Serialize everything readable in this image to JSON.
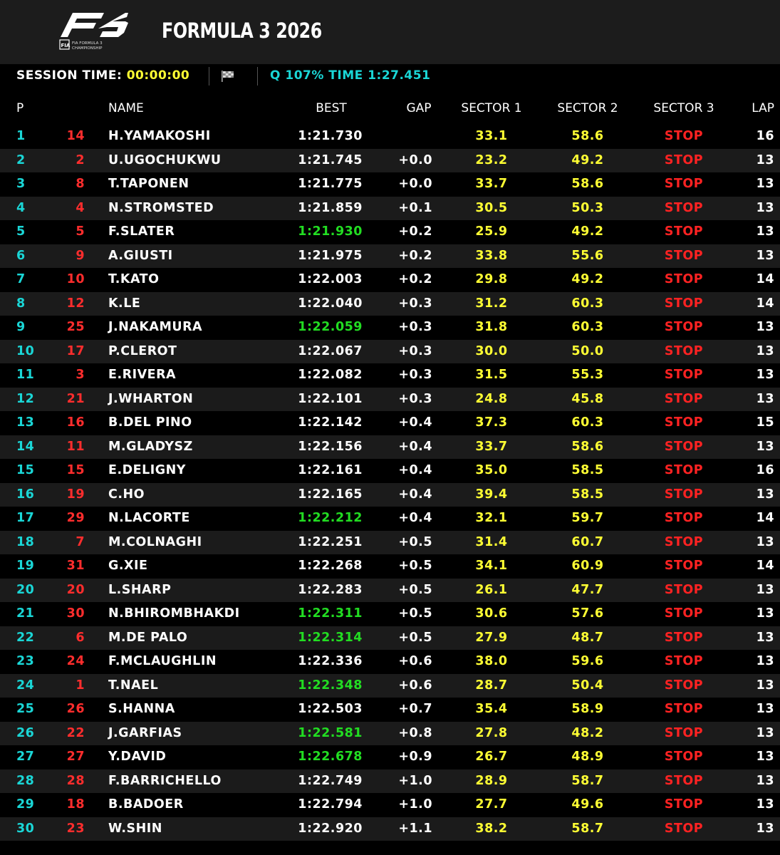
{
  "header": {
    "logo_text": "F3",
    "logo_subtext": "FIA FORMULA 3 CHAMPIONSHIP",
    "title": "FORMULA 3 2026"
  },
  "status": {
    "session_label": "SESSION TIME:",
    "session_time": "00:00:00",
    "q107_label": "Q 107% TIME",
    "q107_time": "1:27.451"
  },
  "columns": {
    "pos": "P",
    "name": "NAME",
    "best": "BEST",
    "gap": "GAP",
    "s1": "SECTOR 1",
    "s2": "SECTOR 2",
    "s3": "SECTOR 3",
    "lap": "LAP"
  },
  "colors": {
    "position": "#1ad6d6",
    "car_number": "#ff2d2d",
    "sector": "#ffff33",
    "stop": "#ff2222",
    "best_personal": "#22dd22",
    "best_normal": "#ffffff"
  },
  "rows": [
    {
      "pos": "1",
      "num": "14",
      "name": "H.YAMAKOSHI",
      "best": "1:21.730",
      "best_green": false,
      "gap": "",
      "s1": "33.1",
      "s2": "58.6",
      "s3": "STOP",
      "lap": "16"
    },
    {
      "pos": "2",
      "num": "2",
      "name": "U.UGOCHUKWU",
      "best": "1:21.745",
      "best_green": false,
      "gap": "+0.0",
      "s1": "23.2",
      "s2": "49.2",
      "s3": "STOP",
      "lap": "13"
    },
    {
      "pos": "3",
      "num": "8",
      "name": "T.TAPONEN",
      "best": "1:21.775",
      "best_green": false,
      "gap": "+0.0",
      "s1": "33.7",
      "s2": "58.6",
      "s3": "STOP",
      "lap": "13"
    },
    {
      "pos": "4",
      "num": "4",
      "name": "N.STROMSTED",
      "best": "1:21.859",
      "best_green": false,
      "gap": "+0.1",
      "s1": "30.5",
      "s2": "50.3",
      "s3": "STOP",
      "lap": "13"
    },
    {
      "pos": "5",
      "num": "5",
      "name": "F.SLATER",
      "best": "1:21.930",
      "best_green": true,
      "gap": "+0.2",
      "s1": "25.9",
      "s2": "49.2",
      "s3": "STOP",
      "lap": "13"
    },
    {
      "pos": "6",
      "num": "9",
      "name": "A.GIUSTI",
      "best": "1:21.975",
      "best_green": false,
      "gap": "+0.2",
      "s1": "33.8",
      "s2": "55.6",
      "s3": "STOP",
      "lap": "13"
    },
    {
      "pos": "7",
      "num": "10",
      "name": "T.KATO",
      "best": "1:22.003",
      "best_green": false,
      "gap": "+0.2",
      "s1": "29.8",
      "s2": "49.2",
      "s3": "STOP",
      "lap": "14"
    },
    {
      "pos": "8",
      "num": "12",
      "name": "K.LE",
      "best": "1:22.040",
      "best_green": false,
      "gap": "+0.3",
      "s1": "31.2",
      "s2": "60.3",
      "s3": "STOP",
      "lap": "14"
    },
    {
      "pos": "9",
      "num": "25",
      "name": "J.NAKAMURA",
      "best": "1:22.059",
      "best_green": true,
      "gap": "+0.3",
      "s1": "31.8",
      "s2": "60.3",
      "s3": "STOP",
      "lap": "13"
    },
    {
      "pos": "10",
      "num": "17",
      "name": "P.CLEROT",
      "best": "1:22.067",
      "best_green": false,
      "gap": "+0.3",
      "s1": "30.0",
      "s2": "50.0",
      "s3": "STOP",
      "lap": "13"
    },
    {
      "pos": "11",
      "num": "3",
      "name": "E.RIVERA",
      "best": "1:22.082",
      "best_green": false,
      "gap": "+0.3",
      "s1": "31.5",
      "s2": "55.3",
      "s3": "STOP",
      "lap": "13"
    },
    {
      "pos": "12",
      "num": "21",
      "name": "J.WHARTON",
      "best": "1:22.101",
      "best_green": false,
      "gap": "+0.3",
      "s1": "24.8",
      "s2": "45.8",
      "s3": "STOP",
      "lap": "13"
    },
    {
      "pos": "13",
      "num": "16",
      "name": "B.DEL PINO",
      "best": "1:22.142",
      "best_green": false,
      "gap": "+0.4",
      "s1": "37.3",
      "s2": "60.3",
      "s3": "STOP",
      "lap": "15"
    },
    {
      "pos": "14",
      "num": "11",
      "name": "M.GLADYSZ",
      "best": "1:22.156",
      "best_green": false,
      "gap": "+0.4",
      "s1": "33.7",
      "s2": "58.6",
      "s3": "STOP",
      "lap": "13"
    },
    {
      "pos": "15",
      "num": "15",
      "name": "E.DELIGNY",
      "best": "1:22.161",
      "best_green": false,
      "gap": "+0.4",
      "s1": "35.0",
      "s2": "58.5",
      "s3": "STOP",
      "lap": "16"
    },
    {
      "pos": "16",
      "num": "19",
      "name": "C.HO",
      "best": "1:22.165",
      "best_green": false,
      "gap": "+0.4",
      "s1": "39.4",
      "s2": "58.5",
      "s3": "STOP",
      "lap": "13"
    },
    {
      "pos": "17",
      "num": "29",
      "name": "N.LACORTE",
      "best": "1:22.212",
      "best_green": true,
      "gap": "+0.4",
      "s1": "32.1",
      "s2": "59.7",
      "s3": "STOP",
      "lap": "14"
    },
    {
      "pos": "18",
      "num": "7",
      "name": "M.COLNAGHI",
      "best": "1:22.251",
      "best_green": false,
      "gap": "+0.5",
      "s1": "31.4",
      "s2": "60.7",
      "s3": "STOP",
      "lap": "13"
    },
    {
      "pos": "19",
      "num": "31",
      "name": "G.XIE",
      "best": "1:22.268",
      "best_green": false,
      "gap": "+0.5",
      "s1": "34.1",
      "s2": "60.9",
      "s3": "STOP",
      "lap": "14"
    },
    {
      "pos": "20",
      "num": "20",
      "name": "L.SHARP",
      "best": "1:22.283",
      "best_green": false,
      "gap": "+0.5",
      "s1": "26.1",
      "s2": "47.7",
      "s3": "STOP",
      "lap": "13"
    },
    {
      "pos": "21",
      "num": "30",
      "name": "N.BHIROMBHAKDI",
      "best": "1:22.311",
      "best_green": true,
      "gap": "+0.5",
      "s1": "30.6",
      "s2": "57.6",
      "s3": "STOP",
      "lap": "13"
    },
    {
      "pos": "22",
      "num": "6",
      "name": "M.DE PALO",
      "best": "1:22.314",
      "best_green": true,
      "gap": "+0.5",
      "s1": "27.9",
      "s2": "48.7",
      "s3": "STOP",
      "lap": "13"
    },
    {
      "pos": "23",
      "num": "24",
      "name": "F.MCLAUGHLIN",
      "best": "1:22.336",
      "best_green": false,
      "gap": "+0.6",
      "s1": "38.0",
      "s2": "59.6",
      "s3": "STOP",
      "lap": "13"
    },
    {
      "pos": "24",
      "num": "1",
      "name": "T.NAEL",
      "best": "1:22.348",
      "best_green": true,
      "gap": "+0.6",
      "s1": "28.7",
      "s2": "50.4",
      "s3": "STOP",
      "lap": "13"
    },
    {
      "pos": "25",
      "num": "26",
      "name": "S.HANNA",
      "best": "1:22.503",
      "best_green": false,
      "gap": "+0.7",
      "s1": "35.4",
      "s2": "58.9",
      "s3": "STOP",
      "lap": "13"
    },
    {
      "pos": "26",
      "num": "22",
      "name": "J.GARFIAS",
      "best": "1:22.581",
      "best_green": true,
      "gap": "+0.8",
      "s1": "27.8",
      "s2": "48.2",
      "s3": "STOP",
      "lap": "13"
    },
    {
      "pos": "27",
      "num": "27",
      "name": "Y.DAVID",
      "best": "1:22.678",
      "best_green": true,
      "gap": "+0.9",
      "s1": "26.7",
      "s2": "48.9",
      "s3": "STOP",
      "lap": "13"
    },
    {
      "pos": "28",
      "num": "28",
      "name": "F.BARRICHELLO",
      "best": "1:22.749",
      "best_green": false,
      "gap": "+1.0",
      "s1": "28.9",
      "s2": "58.7",
      "s3": "STOP",
      "lap": "13"
    },
    {
      "pos": "29",
      "num": "18",
      "name": "B.BADOER",
      "best": "1:22.794",
      "best_green": false,
      "gap": "+1.0",
      "s1": "27.7",
      "s2": "49.6",
      "s3": "STOP",
      "lap": "13"
    },
    {
      "pos": "30",
      "num": "23",
      "name": "W.SHIN",
      "best": "1:22.920",
      "best_green": false,
      "gap": "+1.1",
      "s1": "38.2",
      "s2": "58.7",
      "s3": "STOP",
      "lap": "13"
    }
  ]
}
